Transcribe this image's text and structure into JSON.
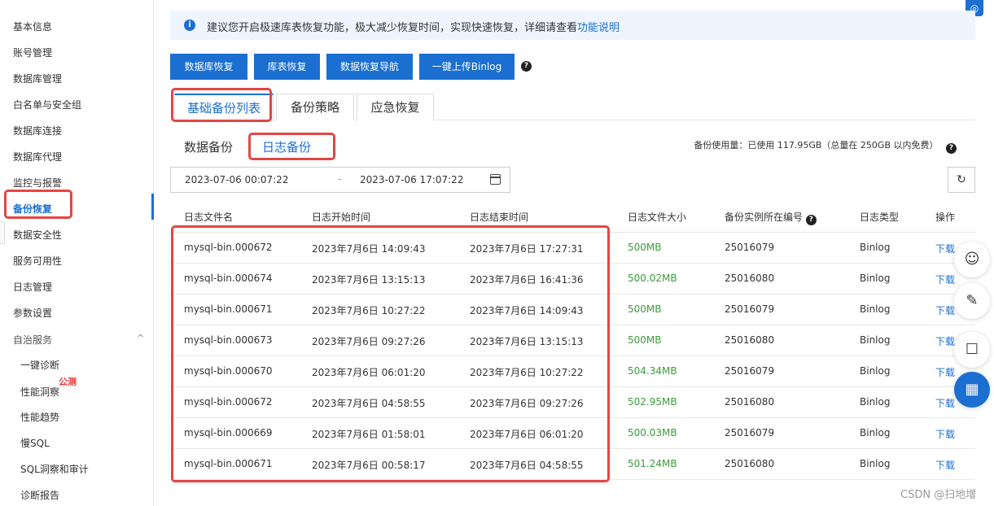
{
  "sidebar": {
    "items": [
      {
        "label": "基本信息"
      },
      {
        "label": "账号管理"
      },
      {
        "label": "数据库管理"
      },
      {
        "label": "白名单与安全组"
      },
      {
        "label": "数据库连接"
      },
      {
        "label": "数据库代理"
      },
      {
        "label": "监控与报警"
      },
      {
        "label": "备份恢复"
      },
      {
        "label": "数据安全性"
      },
      {
        "label": "服务可用性"
      },
      {
        "label": "日志管理"
      },
      {
        "label": "参数设置"
      }
    ],
    "group": {
      "label": "自治服务",
      "chevron": "^"
    },
    "sub_items": [
      {
        "label": "一键诊断"
      },
      {
        "label": "性能洞察"
      },
      {
        "label": "性能趋势"
      },
      {
        "label": "慢SQL"
      },
      {
        "label": "SQL洞察和审计"
      },
      {
        "label": "诊断报告"
      }
    ],
    "beta_tag": "公测"
  },
  "notice": {
    "text": "建议您开启极速库表恢复功能，极大减少恢复时间，实现快速恢复，详细请查看",
    "link": "功能说明"
  },
  "toolbar": {
    "buttons": [
      "数据库恢复",
      "库表恢复",
      "数据恢复导航",
      "一键上传Binlog"
    ]
  },
  "tabs": [
    "基础备份列表",
    "备份策略",
    "应急恢复"
  ],
  "subtabs": [
    "数据备份",
    "日志备份"
  ],
  "usage": "备份使用量：已使用 117.95GB（总量在 250GB 以内免费）",
  "daterange": {
    "start": "2023-07-06 00:07:22",
    "sep": "-",
    "end": "2023-07-06 17:07:22"
  },
  "table": {
    "headers": [
      "日志文件名",
      "日志开始时间",
      "日志结束时间",
      "日志文件大小",
      "备份实例所在编号",
      "日志类型",
      "操作"
    ],
    "rows": [
      [
        "mysql-bin.000672",
        "2023年7月6日 14:09:43",
        "2023年7月6日 17:27:31",
        "500MB",
        "25016079",
        "Binlog",
        "下载"
      ],
      [
        "mysql-bin.000674",
        "2023年7月6日 13:15:13",
        "2023年7月6日 16:41:36",
        "500.02MB",
        "25016080",
        "Binlog",
        "下载"
      ],
      [
        "mysql-bin.000671",
        "2023年7月6日 10:27:22",
        "2023年7月6日 14:09:43",
        "500MB",
        "25016079",
        "Binlog",
        "下载"
      ],
      [
        "mysql-bin.000673",
        "2023年7月6日 09:27:26",
        "2023年7月6日 13:15:13",
        "500MB",
        "25016080",
        "Binlog",
        "下载"
      ],
      [
        "mysql-bin.000670",
        "2023年7月6日 06:01:20",
        "2023年7月6日 10:27:22",
        "504.34MB",
        "25016079",
        "Binlog",
        "下载"
      ],
      [
        "mysql-bin.000672",
        "2023年7月6日 04:58:55",
        "2023年7月6日 09:27:26",
        "502.95MB",
        "25016080",
        "Binlog",
        "下载"
      ],
      [
        "mysql-bin.000669",
        "2023年7月6日 01:58:01",
        "2023年7月6日 06:01:20",
        "500.03MB",
        "25016079",
        "Binlog",
        "下载"
      ],
      [
        "mysql-bin.000671",
        "2023年7月6日 00:58:17",
        "2023年7月6日 04:58:55",
        "501.24MB",
        "25016080",
        "Binlog",
        "下载"
      ]
    ]
  },
  "watermark": "CSDN @扫地增",
  "icons": {
    "info": "i",
    "help": "?",
    "refresh": "↻",
    "corner": "◎",
    "assistant": "☺",
    "edit": "✎",
    "chat": "☐",
    "apps": "▦"
  },
  "colors": {
    "accent": "#1a6fd1",
    "size_text": "#3a9c3a",
    "annotation": "#e54545"
  }
}
